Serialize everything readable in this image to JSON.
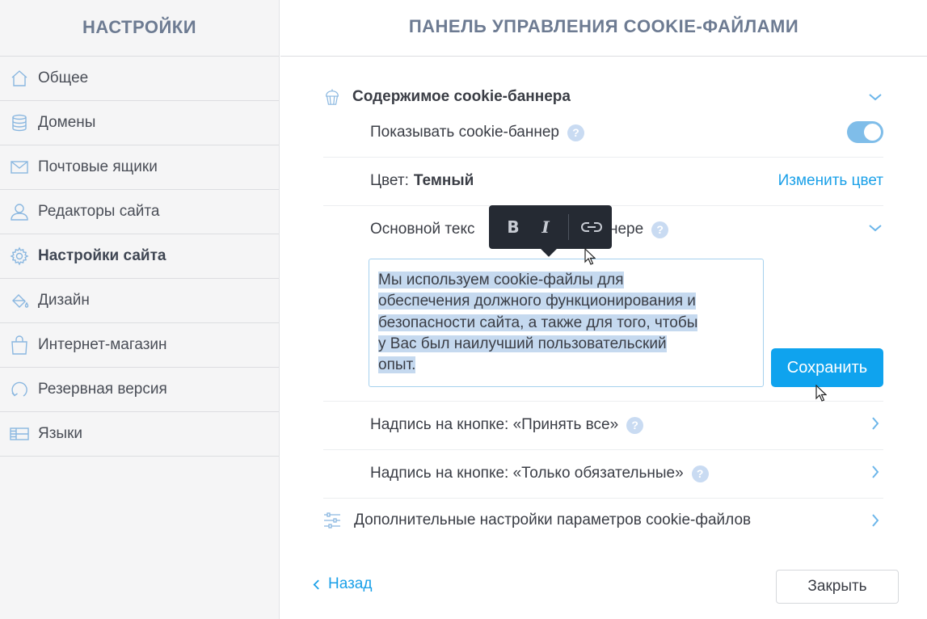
{
  "sidebar": {
    "title": "НАСТРОЙКИ",
    "items": [
      {
        "label": "Общее",
        "icon": "home-icon"
      },
      {
        "label": "Домены",
        "icon": "database-icon"
      },
      {
        "label": "Почтовые ящики",
        "icon": "mail-icon"
      },
      {
        "label": "Редакторы сайта",
        "icon": "user-icon"
      },
      {
        "label": "Настройки сайта",
        "icon": "gear-icon",
        "active": true
      },
      {
        "label": "Дизайн",
        "icon": "paint-bucket-icon"
      },
      {
        "label": "Интернет-магазин",
        "icon": "shopping-bag-icon"
      },
      {
        "label": "Резервная версия",
        "icon": "backup-icon"
      },
      {
        "label": "Языки",
        "icon": "languages-icon"
      }
    ]
  },
  "main": {
    "title": "ПАНЕЛЬ УПРАВЛЕНИЯ COOKIE-ФАЙЛАМИ",
    "section": {
      "title": "Содержимое cookie-баннера",
      "icon": "cupcake-icon",
      "show_banner_label": "Показывать cookie-баннер",
      "show_banner_enabled": true,
      "color_label": "Цвет:",
      "color_value": "Темный",
      "change_color_link": "Изменить цвет",
      "main_text_label_start": "Основной текс",
      "main_text_label_end": "ннере",
      "main_text_lines": [
        "Мы используем cookie-файлы для",
        "обеспечения должного функционирования и",
        "безопасности сайта, а также для того, чтобы",
        "у Вас был наилучший пользовательский",
        "опыт."
      ],
      "save_button": "Сохранить",
      "accept_all_label": "Надпись на кнопке: «Принять все»",
      "required_only_label": "Надпись на кнопке: «Только обязательные»"
    },
    "advanced_label": "Дополнительные настройки параметров cookie-файлов",
    "help_glyph": "?"
  },
  "toolbar": {
    "bold": "B",
    "italic": "I"
  },
  "footer": {
    "back_label": "Назад",
    "close_button": "Закрыть"
  },
  "colors": {
    "accent": "#0fa3ee",
    "link": "#1aa0e8",
    "toggle": "#7fbde9",
    "sidebar_bg": "#f5f5f6",
    "heading": "#6d7b92"
  }
}
